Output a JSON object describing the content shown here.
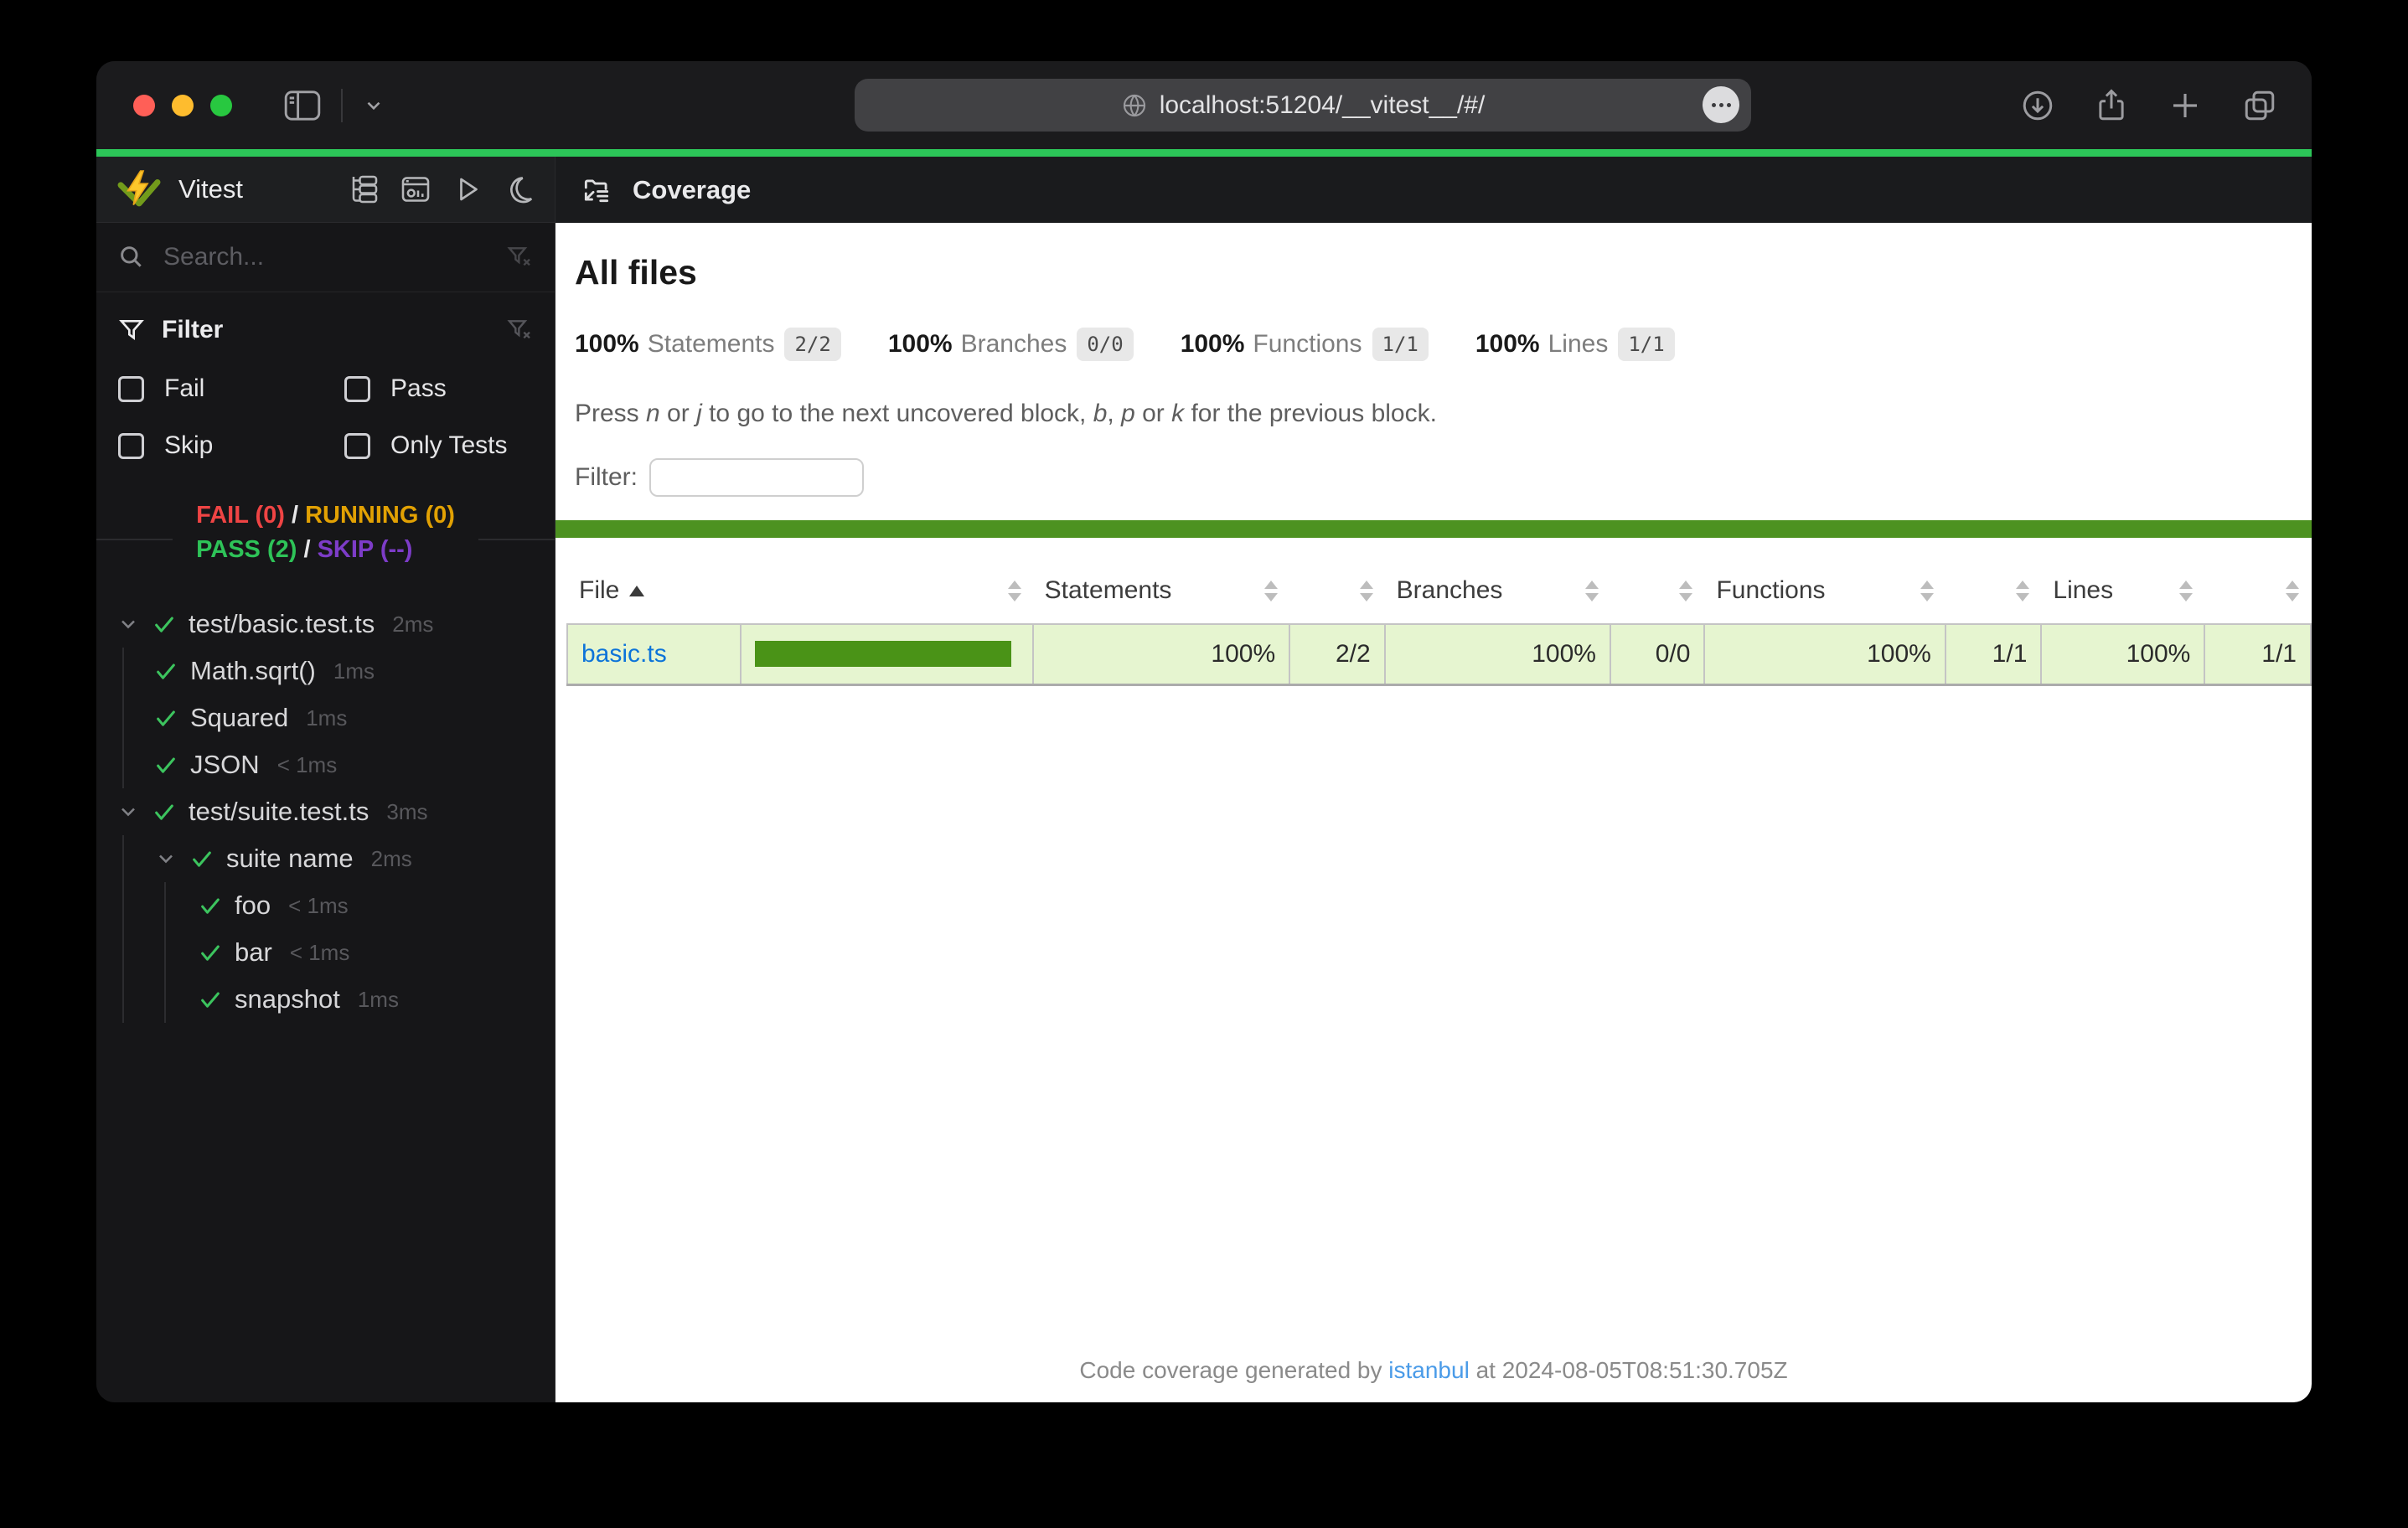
{
  "browser": {
    "url": "localhost:51204/__vitest__/#/",
    "icons": [
      "close-button",
      "minimize-button",
      "zoom-button",
      "sidebar-toggle-icon",
      "chevron-down-icon",
      "globe-icon",
      "ellipsis-icon",
      "download-icon",
      "share-icon",
      "new-tab-icon",
      "tab-overview-icon"
    ]
  },
  "sidebar": {
    "app_name": "Vitest",
    "header_icons": [
      "tree-view-icon",
      "dashboard-icon",
      "run-all-icon",
      "dark-mode-icon"
    ],
    "search_placeholder": "Search...",
    "filter": {
      "title": "Filter",
      "checkboxes": [
        {
          "label": "Fail"
        },
        {
          "label": "Pass"
        },
        {
          "label": "Skip"
        },
        {
          "label": "Only Tests"
        }
      ]
    },
    "status": {
      "fail": "FAIL (0)",
      "running": "RUNNING (0)",
      "pass": "PASS (2)",
      "skip": "SKIP (--)",
      "separator": "/"
    },
    "tree": [
      {
        "label": "test/basic.test.ts",
        "duration": "2ms"
      },
      {
        "label": "Math.sqrt()",
        "duration": "1ms"
      },
      {
        "label": "Squared",
        "duration": "1ms"
      },
      {
        "label": "JSON",
        "duration": "< 1ms"
      },
      {
        "label": "test/suite.test.ts",
        "duration": "3ms"
      },
      {
        "label": "suite name",
        "duration": "2ms"
      },
      {
        "label": "foo",
        "duration": "< 1ms"
      },
      {
        "label": "bar",
        "duration": "< 1ms"
      },
      {
        "label": "snapshot",
        "duration": "1ms"
      }
    ]
  },
  "coverage": {
    "tab_title": "Coverage",
    "heading": "All files",
    "stats": [
      {
        "pct": "100%",
        "label": "Statements",
        "ratio": "2/2"
      },
      {
        "pct": "100%",
        "label": "Branches",
        "ratio": "0/0"
      },
      {
        "pct": "100%",
        "label": "Functions",
        "ratio": "1/1"
      },
      {
        "pct": "100%",
        "label": "Lines",
        "ratio": "1/1"
      }
    ],
    "hint_parts": [
      {
        "t": "Press "
      },
      {
        "t": "n"
      },
      {
        "t": " or "
      },
      {
        "t": "j"
      },
      {
        "t": " to go to the next uncovered block, "
      },
      {
        "t": "b"
      },
      {
        "t": ", "
      },
      {
        "t": "p"
      },
      {
        "t": " or "
      },
      {
        "t": "k"
      },
      {
        "t": " for the previous block."
      }
    ],
    "filter_label": "Filter:",
    "filter_value": "",
    "table": {
      "headers": {
        "file": "File",
        "statements": "Statements",
        "branches": "Branches",
        "functions": "Functions",
        "lines": "Lines"
      },
      "rows": [
        {
          "file": "basic.ts",
          "bar_pct": "100",
          "statements": "100%",
          "statements_ratio": "2/2",
          "branches": "100%",
          "branches_ratio": "0/0",
          "functions": "100%",
          "functions_ratio": "1/1",
          "lines": "100%",
          "lines_ratio": "1/1"
        }
      ]
    },
    "colors": {
      "banner_green": "#4d9221",
      "row_green": "#e6f5d0",
      "accent_green": "#2cc558"
    },
    "footer": {
      "prefix": "Code coverage generated by ",
      "link": "istanbul",
      "suffix": " at 2024-08-05T08:51:30.705Z"
    }
  }
}
